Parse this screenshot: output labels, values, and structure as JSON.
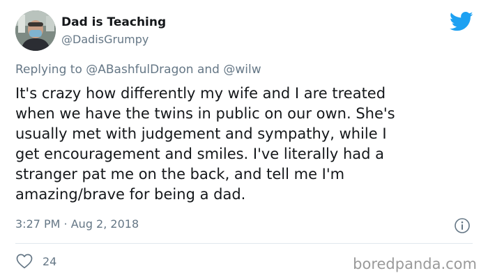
{
  "author": {
    "name": "Dad is Teaching",
    "handle": "@DadisGrumpy"
  },
  "reply": {
    "prefix": "Replying to ",
    "mention1": "@ABashfulDragon",
    "joiner": " and ",
    "mention2": "@wilw"
  },
  "tweet": {
    "text": "It's crazy how differently my wife and I are treated\nwhen we have the twins in public on our own. She's\nusually met with judgement and sympathy, while I\nget encouragement and smiles. I've literally had a\nstranger pat me on the back, and tell me I'm\namazing/brave for being a dad.",
    "timestamp": "3:27 PM · Aug 2, 2018"
  },
  "actions": {
    "like_count": "24"
  },
  "watermark": "boredpanda.com",
  "icons": {
    "brand": "twitter-bird-icon",
    "info": "info-icon",
    "like": "heart-icon"
  },
  "colors": {
    "twitter_blue": "#1da1f2",
    "secondary_text": "#657786",
    "primary_text": "#14171a",
    "divider": "#e1e8ed"
  }
}
